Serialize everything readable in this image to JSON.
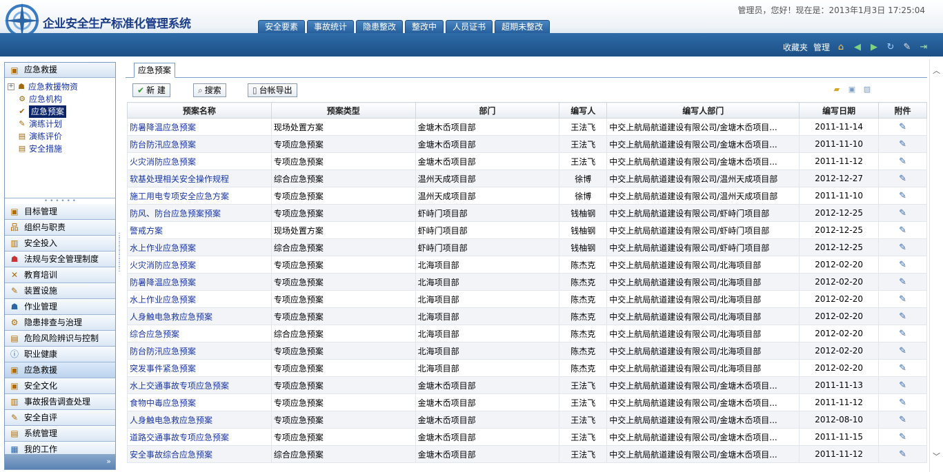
{
  "header": {
    "app_title": "企业安全生产标准化管理系统",
    "welcome": "管理员，您好！现在是：2013年1月3日  17:25:04",
    "nav_tabs": [
      "安全要素",
      "事故统计",
      "隐患整改",
      "整改中",
      "人员证书",
      "超期未整改"
    ],
    "toolbar": {
      "favorites": "收藏夹",
      "manage": "管理"
    }
  },
  "sidebar": {
    "top_section": "应急救援",
    "tree": [
      {
        "label": "应急救援物资",
        "icon": "people-icon"
      },
      {
        "label": "应急机构",
        "icon": "org-icon"
      },
      {
        "label": "应急预案",
        "icon": "check-icon"
      },
      {
        "label": "演练计划",
        "icon": "edit-icon"
      },
      {
        "label": "演练评价",
        "icon": "note-icon"
      },
      {
        "label": "安全措施",
        "icon": "note-icon"
      }
    ],
    "menu": [
      "目标管理",
      "组织与职责",
      "安全投入",
      "法规与安全管理制度",
      "教育培训",
      "装置设施",
      "作业管理",
      "隐患排查与治理",
      "危险风险辨识与控制",
      "职业健康",
      "应急救援",
      "安全文化",
      "事故报告调查处理",
      "安全自评",
      "系统管理",
      "我的工作"
    ]
  },
  "main": {
    "active_tab": "应急预案",
    "actions": {
      "new": "新 建",
      "search": "搜索",
      "export": "台帐导出"
    },
    "columns": [
      "预案名称",
      "预案类型",
      "部门",
      "编写人",
      "编写人部门",
      "编写日期",
      "附件"
    ],
    "rows": [
      [
        "防暑降温应急预案",
        "现场处置方案",
        "金塘木岙项目部",
        "王法飞",
        "中交上航局航道建设有限公司/金塘木岙项目...",
        "2011-11-14"
      ],
      [
        "防台防汛应急预案",
        "专项应急预案",
        "金塘木岙项目部",
        "王法飞",
        "中交上航局航道建设有限公司/金塘木岙项目...",
        "2011-11-10"
      ],
      [
        "火灾消防应急预案",
        "专项应急预案",
        "金塘木岙项目部",
        "王法飞",
        "中交上航局航道建设有限公司/金塘木岙项目...",
        "2011-11-12"
      ],
      [
        "软基处理相关安全操作规程",
        "综合应急预案",
        "温州天成项目部",
        "徐博",
        "中交上航局航道建设有限公司/温州天成项目部",
        "2012-12-27"
      ],
      [
        "施工用电专项安全应急方案",
        "专项应急预案",
        "温州天成项目部",
        "徐博",
        "中交上航局航道建设有限公司/温州天成项目部",
        "2011-11-10"
      ],
      [
        "防风、防台应急预案预案",
        "专项应急预案",
        "虾峙门项目部",
        "钱柚钢",
        "中交上航局航道建设有限公司/虾峙门项目部",
        "2012-12-25"
      ],
      [
        "警戒方案",
        "现场处置方案",
        "虾峙门项目部",
        "钱柚钢",
        "中交上航局航道建设有限公司/虾峙门项目部",
        "2012-12-25"
      ],
      [
        "水上作业应急预案",
        "综合应急预案",
        "虾峙门项目部",
        "钱柚钢",
        "中交上航局航道建设有限公司/虾峙门项目部",
        "2012-12-25"
      ],
      [
        "火灾消防应急预案",
        "专项应急预案",
        "北海项目部",
        "陈杰克",
        "中交上航局航道建设有限公司/北海项目部",
        "2012-02-20"
      ],
      [
        "防暑降温应急预案",
        "专项应急预案",
        "北海项目部",
        "陈杰克",
        "中交上航局航道建设有限公司/北海项目部",
        "2012-02-20"
      ],
      [
        "水上作业应急预案",
        "专项应急预案",
        "北海项目部",
        "陈杰克",
        "中交上航局航道建设有限公司/北海项目部",
        "2012-02-20"
      ],
      [
        "人身触电急救应急预案",
        "专项应急预案",
        "北海项目部",
        "陈杰克",
        "中交上航局航道建设有限公司/北海项目部",
        "2012-02-20"
      ],
      [
        "综合应急预案",
        "综合应急预案",
        "北海项目部",
        "陈杰克",
        "中交上航局航道建设有限公司/北海项目部",
        "2012-02-20"
      ],
      [
        "防台防汛应急预案",
        "专项应急预案",
        "北海项目部",
        "陈杰克",
        "中交上航局航道建设有限公司/北海项目部",
        "2012-02-20"
      ],
      [
        "突发事件紧急预案",
        "专项应急预案",
        "北海项目部",
        "陈杰克",
        "中交上航局航道建设有限公司/北海项目部",
        "2012-02-20"
      ],
      [
        "水上交通事故专项应急预案",
        "专项应急预案",
        "金塘木岙项目部",
        "王法飞",
        "中交上航局航道建设有限公司/金塘木岙项目...",
        "2011-11-13"
      ],
      [
        "食物中毒应急预案",
        "专项应急预案",
        "金塘木岙项目部",
        "王法飞",
        "中交上航局航道建设有限公司/金塘木岙项目...",
        "2011-11-12"
      ],
      [
        "人身触电急救应急预案",
        "专项应急预案",
        "金塘木岙项目部",
        "王法飞",
        "中交上航局航道建设有限公司/金塘木岙项目...",
        "2012-08-10"
      ],
      [
        "道路交通事故专项应急预案",
        "专项应急预案",
        "金塘木岙项目部",
        "王法飞",
        "中交上航局航道建设有限公司/金塘木岙项目...",
        "2011-11-15"
      ],
      [
        "安全事故综合应急预案",
        "综合应急预案",
        "金塘木岙项目部",
        "王法飞",
        "中交上航局航道建设有限公司/金塘木岙项目...",
        "2011-11-12"
      ]
    ]
  },
  "colors": {
    "header_bar": "#1c4f86",
    "link": "#1a37a6",
    "selected": "#0a246a"
  }
}
